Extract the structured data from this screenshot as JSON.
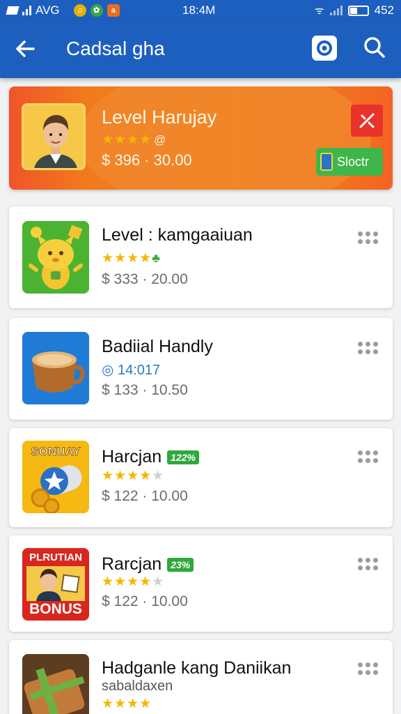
{
  "status_bar": {
    "carrier": "AVG",
    "time": "18:4M",
    "battery": "452"
  },
  "app_bar": {
    "title": "Cadsal gha",
    "back_icon": "arrow-left-icon",
    "settings_icon": "gear-icon",
    "search_icon": "search-icon"
  },
  "featured": {
    "title": "Level Harujay",
    "rating": 4,
    "price": "$ 396 · 30.00",
    "action_label": "Sloctr",
    "close_icon": "close-icon",
    "accent": "#f27a1c"
  },
  "items": [
    {
      "name": "Level : kamgaaiuan",
      "rating": 4,
      "price": "$ 333 · 20.00"
    },
    {
      "name": "Badiial Handly",
      "sub": "◎ 14:017",
      "price": "$ 133 · 10.50"
    },
    {
      "name": "Harcjan",
      "badge": "122%",
      "rating": 4,
      "price": "$ 122 · 10.00",
      "thumb_text": "SONUAY"
    },
    {
      "name": "Rarcjan",
      "badge": "23%",
      "rating": 4,
      "price": "$ 122 · 10.00",
      "thumb_text_top": "PLRUTIAN",
      "thumb_text_bottom": "BONUS"
    },
    {
      "name": "Hadganle kang Daniikan",
      "sub": "sabaldaxen",
      "rating": 4
    }
  ],
  "colors": {
    "app_bar": "#1d5fbf",
    "star": "#f5b700",
    "badge": "#2fa83b"
  }
}
